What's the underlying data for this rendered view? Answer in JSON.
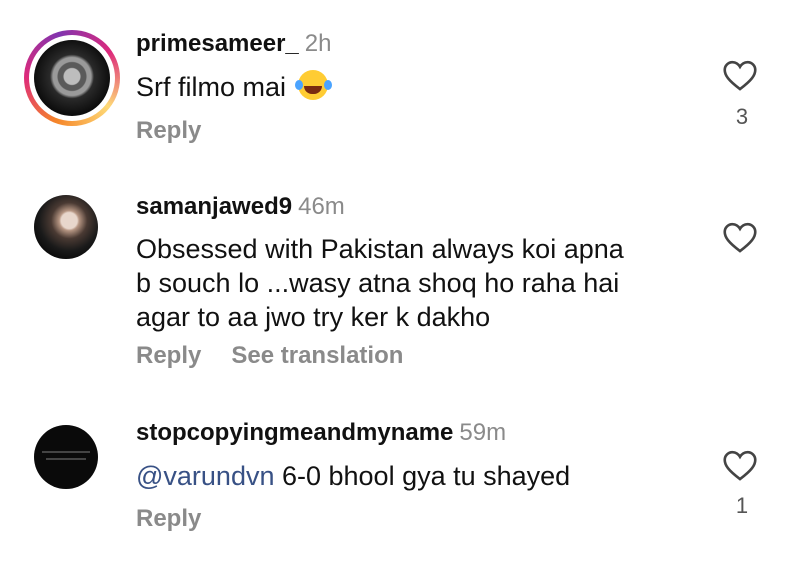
{
  "comments": [
    {
      "username": "primesameer_",
      "time": "2h",
      "text": "Srf filmo mai",
      "emoji": "laughing-tears-emoji",
      "reply_label": "Reply",
      "like_count": "3",
      "avatar": "rose-avatar"
    },
    {
      "username": "samanjawed9",
      "time": "46m",
      "text_lines": [
        "Obsessed with Pakistan always koi apna",
        "b souch lo ...wasy atna shoq ho raha hai",
        "agar to aa jwo try ker k dakho"
      ],
      "reply_label": "Reply",
      "translate_label": "See translation",
      "avatar": "profile-photo-avatar"
    },
    {
      "username": "stopcopyingmeandmyname",
      "time": "59m",
      "mention": "@varundvn",
      "text": " 6-0 bhool gya tu shayed",
      "reply_label": "Reply",
      "like_count": "1",
      "avatar": "text-avatar"
    }
  ],
  "colors": {
    "username": "#111111",
    "meta": "#8a8a8a",
    "mention": "#385185",
    "background": "#ffffff"
  }
}
